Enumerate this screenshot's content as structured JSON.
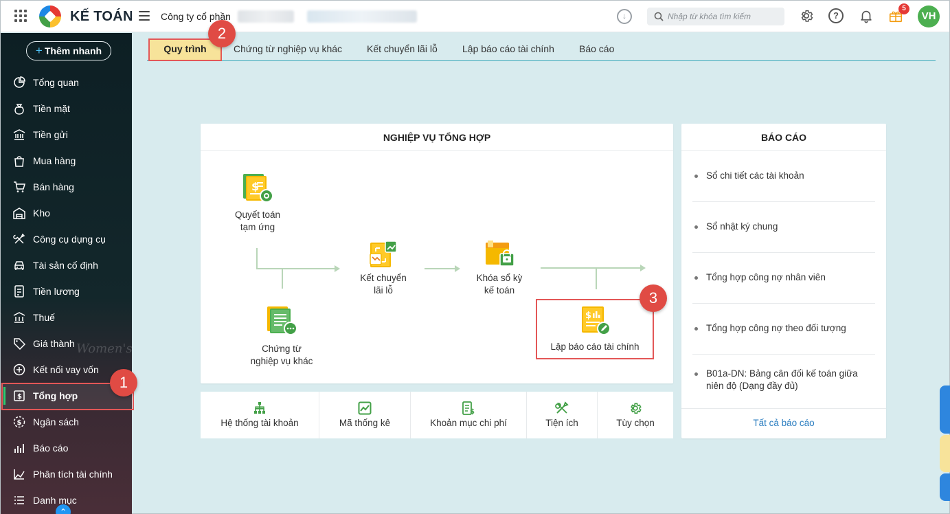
{
  "header": {
    "app_title": "KẾ TOÁN",
    "company": "Công ty cổ phần",
    "search_placeholder": "Nhập từ khóa tìm kiếm",
    "notification_count": "5",
    "avatar_initials": "VH"
  },
  "sidebar": {
    "quick_add_label": "Thêm nhanh",
    "items": [
      {
        "label": "Tổng quan",
        "icon": "dashboard-icon"
      },
      {
        "label": "Tiền mặt",
        "icon": "money-bag-icon"
      },
      {
        "label": "Tiền gửi",
        "icon": "bank-icon"
      },
      {
        "label": "Mua hàng",
        "icon": "shopping-bag-icon"
      },
      {
        "label": "Bán hàng",
        "icon": "cart-icon"
      },
      {
        "label": "Kho",
        "icon": "warehouse-icon"
      },
      {
        "label": "Công cụ dụng cụ",
        "icon": "tools-icon"
      },
      {
        "label": "Tài sản cố định",
        "icon": "car-icon"
      },
      {
        "label": "Tiền lương",
        "icon": "payroll-icon"
      },
      {
        "label": "Thuế",
        "icon": "tax-icon"
      },
      {
        "label": "Giá thành",
        "icon": "price-tag-icon"
      },
      {
        "label": "Kết nối vay vốn",
        "icon": "loan-icon"
      },
      {
        "label": "Tổng hợp",
        "icon": "summary-icon"
      },
      {
        "label": "Ngân sách",
        "icon": "budget-icon"
      },
      {
        "label": "Báo cáo",
        "icon": "report-icon"
      },
      {
        "label": "Phân tích tài chính",
        "icon": "analytics-icon"
      },
      {
        "label": "Danh mục",
        "icon": "list-icon"
      }
    ],
    "active_index": 12,
    "decoration_text": "Women's"
  },
  "markers": {
    "one": "1",
    "two": "2",
    "three": "3"
  },
  "tabs": [
    {
      "label": "Quy trình"
    },
    {
      "label": "Chứng từ nghiệp vụ khác"
    },
    {
      "label": "Kết chuyển lãi lỗ"
    },
    {
      "label": "Lập báo cáo tài chính"
    },
    {
      "label": "Báo cáo"
    }
  ],
  "process_panel": {
    "title": "NGHIỆP VỤ TỔNG HỢP",
    "nodes": {
      "quyet_toan_line1": "Quyết toán",
      "quyet_toan_line2": "tạm ứng",
      "chung_tu_line1": "Chứng từ",
      "chung_tu_line2": "nghiệp vụ khác",
      "ket_chuyen_line1": "Kết chuyển",
      "ket_chuyen_line2": "lãi lỗ",
      "khoa_so_line1": "Khóa sổ kỳ",
      "khoa_so_line2": "kế toán",
      "lap_bao_cao": "Lập báo cáo tài chính"
    }
  },
  "tools": [
    {
      "label": "Hệ thống tài khoản",
      "icon": "account-tree-icon"
    },
    {
      "label": "Mã thống kê",
      "icon": "statistics-code-icon"
    },
    {
      "label": "Khoản mục chi phí",
      "icon": "expense-item-icon"
    },
    {
      "label": "Tiện ích",
      "icon": "utilities-icon"
    },
    {
      "label": "Tùy chọn",
      "icon": "settings-icon"
    }
  ],
  "reports_panel": {
    "title": "BÁO CÁO",
    "items": [
      {
        "line1": "Sổ chi tiết các tài khoản",
        "line2": ""
      },
      {
        "line1": "Sổ nhật ký chung",
        "line2": ""
      },
      {
        "line1": "Tổng hợp công nợ nhân viên",
        "line2": ""
      },
      {
        "line1": "Tổng hợp công nợ theo đối tượng",
        "line2": ""
      },
      {
        "line1": "B01a-DN: Bảng cân đối kế toán giữa",
        "line2": "niên độ (Dạng đầy đủ)"
      }
    ],
    "all_link": "Tất cả báo cáo"
  },
  "colors": {
    "accent_green": "#4caf50",
    "active_tab": "#f7e39a",
    "marker_red": "#e04b44",
    "link_blue": "#2a7dc0"
  }
}
